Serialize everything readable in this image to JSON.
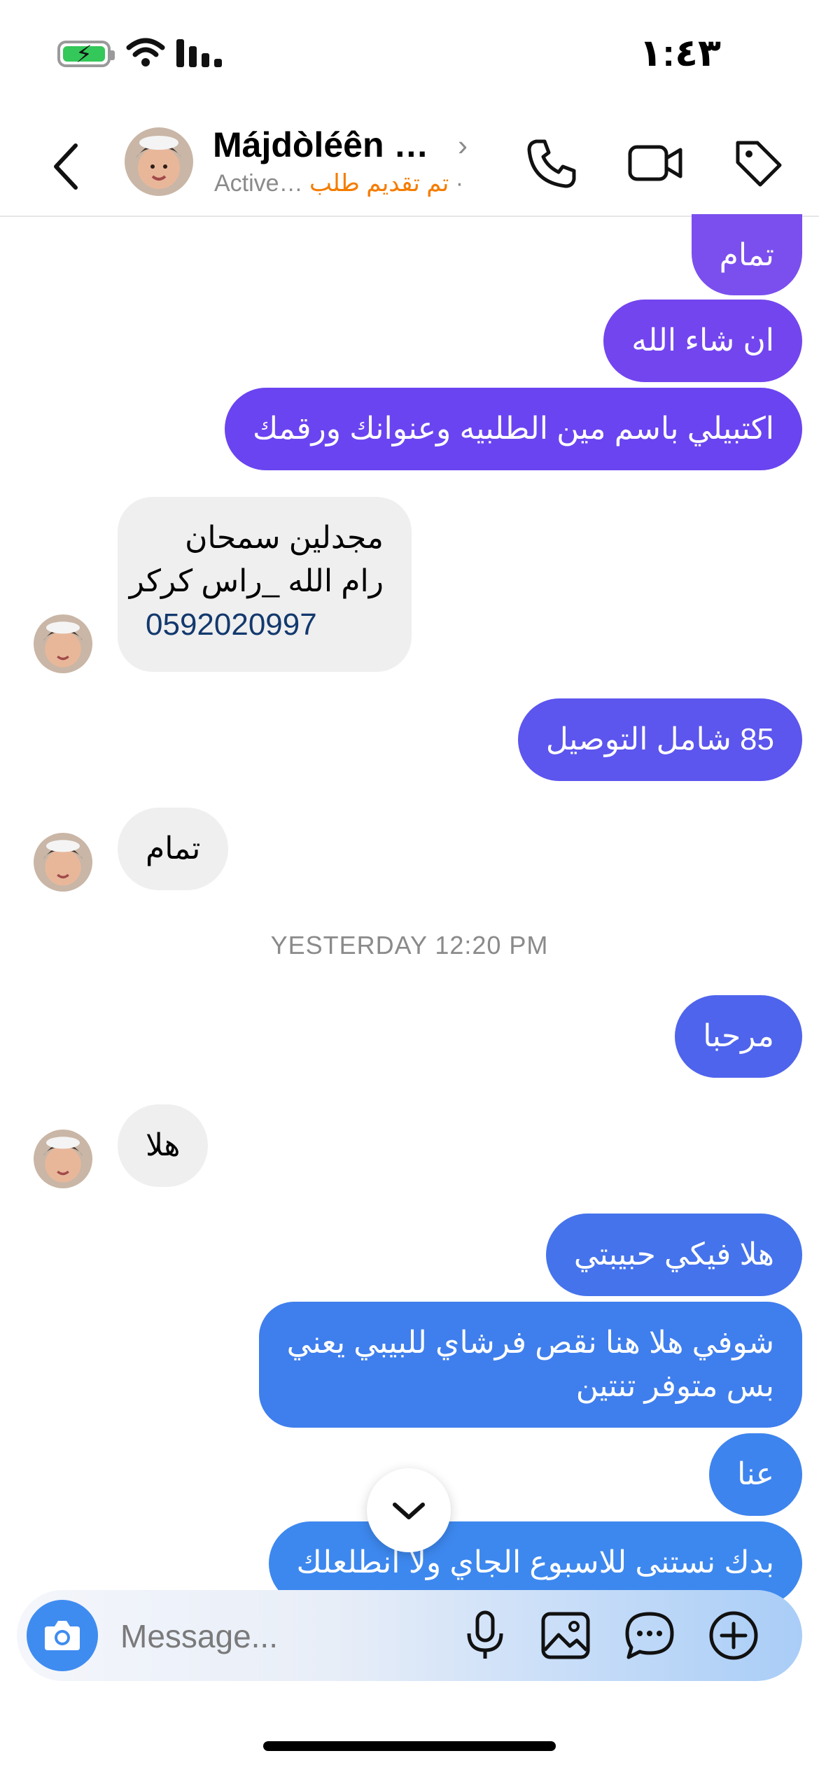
{
  "status_bar": {
    "time": "١:٤٣",
    "battery_icon": "battery-charging-icon",
    "wifi_icon": "wifi-icon",
    "signal_icon": "signal-icon"
  },
  "header": {
    "contact_name": "Májdòléên Ã…",
    "activity": "Active…",
    "label_tag": "تم تقديم طلب",
    "tag_color": "#f57c00"
  },
  "messages": [
    {
      "side": "out",
      "text": "تمام",
      "color": "#7b4fee"
    },
    {
      "side": "out",
      "text": "ان شاء الله",
      "color": "#7345ef"
    },
    {
      "side": "out",
      "text": "اكتبيلي باسم مين الطلبيه وعنوانك ورقمك",
      "color": "#6a44f0"
    },
    {
      "side": "in",
      "line1": "مجدلين سمحان",
      "line2": "رام الله _راس كركر",
      "phone": "0592020997"
    },
    {
      "side": "out",
      "text": "85 شامل التوصيل",
      "color": "#5c55ee"
    },
    {
      "side": "in",
      "text": "تمام"
    },
    {
      "side": "out",
      "text": "مرحبا",
      "color": "#4f64ec"
    },
    {
      "side": "in",
      "text": "هلا"
    },
    {
      "side": "out",
      "text": "هلا فيكي حبيبتي",
      "color": "#4573ec"
    },
    {
      "side": "out",
      "line1": "شوفي هلا هنا نقص فرشاي للبيبي يعني",
      "line2": "بس متوفر تنتين",
      "color": "#3f7eed"
    },
    {
      "side": "out",
      "text": "عنا",
      "color": "#3e84ee"
    },
    {
      "side": "out",
      "text": "بدك نستنى للاسبوع الجاي ولا انطلعلك",
      "color": "#3d88ef"
    }
  ],
  "timestamp": "YESTERDAY 12:20 PM",
  "composer": {
    "placeholder": "Message...",
    "camera_icon": "camera-icon",
    "mic_icon": "microphone-icon",
    "gallery_icon": "image-icon",
    "sticker_icon": "chat-bubble-icon",
    "more_icon": "plus-circle-icon"
  },
  "colors": {
    "accent_blue": "#3f8cf0",
    "incoming_bubble": "#efefef"
  }
}
